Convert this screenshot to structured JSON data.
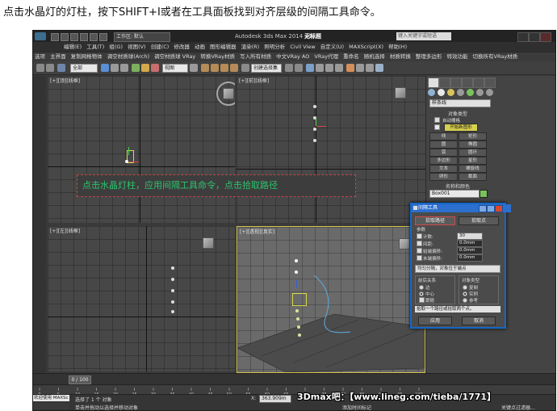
{
  "caption": "点击水晶灯的灯柱，按下SHIFT+I或者在工具面板找到对齐层级的间隔工具命令。",
  "titlebar": {
    "workspace": "工作区: 默认",
    "app_title": "Autodesk 3ds Max  2014 x64",
    "document": "无标题",
    "search_placeholder": "键入关键字或短语"
  },
  "ribbon_tabs": [
    "编辑(E)",
    "工具(T)",
    "组(G)",
    "视图(V)",
    "创建(C)",
    "修改器",
    "动画",
    "图形编辑器",
    "渲染(R)",
    "照明分析",
    "Civil View",
    "自定义(U)",
    "MAXScript(X)",
    "帮助(H)"
  ],
  "menu_items": [
    "选项",
    "主界面",
    "复制网格物体",
    "调空材质球(Arch)",
    "调空材质球 VRay",
    "转换VRay材质",
    "写入所有材质",
    "中文VRay AO",
    "VRay代理",
    "重命名",
    "随机选择",
    "材质转换",
    "整理多边形",
    "特效功能",
    "切换所有VRay材质"
  ],
  "toolbar": {
    "selection_filter": "全部",
    "view_dropdown": "视图",
    "named_selection": "创建选择集"
  },
  "viewports": {
    "top_label": "[+][顶][线框]",
    "front_label": "[+][前][线框]",
    "left_label": "[+][左][线框]",
    "perspective_label": "[+][透视][真实]"
  },
  "annotation": "点击水晶灯柱，应用间隔工具命令，点击拾取路径",
  "command_panel": {
    "category": "样条线",
    "object_type_header": "对象类型",
    "autogrid": "自动栅格",
    "start_new_shape": "开始新图形",
    "buttons": [
      "线",
      "矩形",
      "圆",
      "椭圆",
      "弧",
      "圆环",
      "多边形",
      "星形",
      "文本",
      "螺旋线",
      "卵形",
      "截面"
    ],
    "name_color_header": "名称和颜色",
    "object_name": "Box001"
  },
  "spacing_tool": {
    "title": "间隔工具",
    "pick_path": "拾取路径",
    "pick_points": "拾取点",
    "params_header": "参数",
    "count_label": "计数:",
    "count_value": "30",
    "spacing_label": "间距:",
    "spacing_value": "0.0mm",
    "start_offset_label": "始端偏移:",
    "start_offset_value": "0.0mm",
    "end_offset_label": "末端偏移:",
    "end_offset_value": "0.0mm",
    "distribution": "均匀分隔，对象位于端点",
    "context_header": "前后关系",
    "context_edges": "边",
    "context_centers": "中心",
    "follow": "跟随",
    "object_type_header": "对象类型",
    "copy": "复制",
    "instance": "实例",
    "reference": "参考",
    "status": "拾取一个路径或拾取两个点。",
    "apply": "应用",
    "cancel": "取消"
  },
  "timeline": {
    "frame": "0 / 100",
    "ticks": [
      "0",
      "5",
      "10",
      "15",
      "20",
      "25",
      "30",
      "35",
      "40",
      "45",
      "50",
      "55",
      "60",
      "65",
      "70",
      "75",
      "80",
      "85",
      "90",
      "95",
      "100"
    ]
  },
  "status": {
    "maxscript": "欢迎使用 MAXSc",
    "selected": "选择了 1 个 对象",
    "hint": "单击并拖动以选择并移动对象",
    "x_label": "X:",
    "x_value": "363.909m",
    "key_filter": "关键点过滤器...",
    "add_time_tag": "添加时间标记"
  },
  "watermark": "3Dmax吧：【www.lineg.com/tieba/1771】",
  "colors": {
    "accent_blue": "#2c6fcd",
    "annotation_green": "#2bc46c",
    "annotation_border": "#c24646",
    "active_viewport": "#d6c34a"
  }
}
